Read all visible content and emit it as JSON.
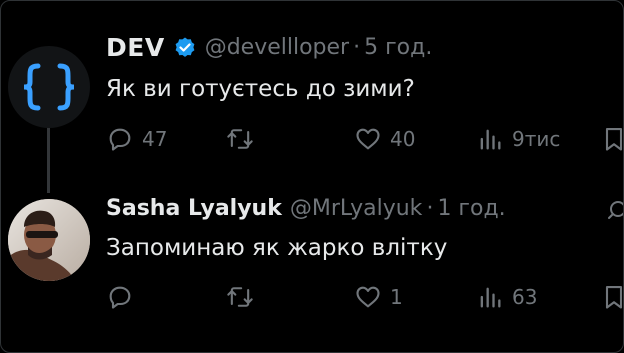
{
  "tweets": [
    {
      "author": "DEV",
      "verified": true,
      "handle": "@devellloper",
      "separator": "·",
      "time": "5 год.",
      "text": "Як ви готуєтесь до зими?",
      "avatar_icon": "curly-braces-logo",
      "actions": {
        "reply": "47",
        "repost": "",
        "like": "40",
        "views": "9тис"
      }
    },
    {
      "author": "Sasha Lyalyuk",
      "verified": false,
      "handle": "@MrLyalyuk",
      "separator": "·",
      "time": "1 год.",
      "text": "Запоминаю як жарко влітку",
      "avatar_icon": "profile-photo",
      "actions": {
        "reply": "",
        "repost": "",
        "like": "1",
        "views": "63"
      }
    }
  ],
  "colors": {
    "background": "#000000",
    "text": "#e7e9ea",
    "muted": "#71767b",
    "verified": "#1d9bf0",
    "logo": "#3aa0ff"
  }
}
